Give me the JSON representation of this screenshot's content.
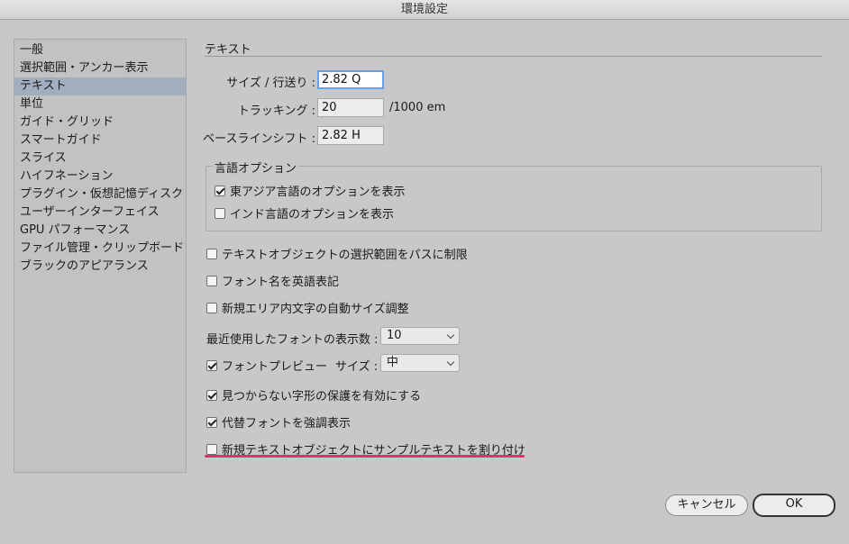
{
  "window": {
    "title": "環境設定"
  },
  "sidebar": {
    "items": [
      {
        "label": "一般"
      },
      {
        "label": "選択範囲・アンカー表示"
      },
      {
        "label": "テキスト"
      },
      {
        "label": "単位"
      },
      {
        "label": "ガイド・グリッド"
      },
      {
        "label": "スマートガイド"
      },
      {
        "label": "スライス"
      },
      {
        "label": "ハイフネーション"
      },
      {
        "label": "プラグイン・仮想記憶ディスク"
      },
      {
        "label": "ユーザーインターフェイス"
      },
      {
        "label": "GPU パフォーマンス"
      },
      {
        "label": "ファイル管理・クリップボード"
      },
      {
        "label": "ブラックのアピアランス"
      }
    ],
    "selected": "テキスト"
  },
  "panel": {
    "section_title": "テキスト",
    "size_leading": {
      "label": "サイズ / 行送り :",
      "value": "2.82 Q"
    },
    "tracking": {
      "label": "トラッキング :",
      "value": "20",
      "unit": "/1000 em"
    },
    "baseline_shift": {
      "label": "ベースラインシフト :",
      "value": "2.82 H"
    },
    "language_options": {
      "title": "言語オプション",
      "east_asian": {
        "label": "東アジア言語のオプションを表示",
        "checked": true
      },
      "indic": {
        "label": "インド言語のオプションを表示",
        "checked": false
      }
    },
    "limit_selection": {
      "label": "テキストオブジェクトの選択範囲をパスに制限",
      "checked": false
    },
    "font_names_english": {
      "label": "フォント名を英語表記",
      "checked": false
    },
    "auto_size_area": {
      "label": "新規エリア内文字の自動サイズ調整",
      "checked": false
    },
    "recent_fonts": {
      "label": "最近使用したフォントの表示数 :",
      "value": "10"
    },
    "font_preview": {
      "label": "フォントプレビュー",
      "checked": true,
      "size_label": "サイズ :",
      "size_value": "中"
    },
    "missing_glyph": {
      "label": "見つからない字形の保護を有効にする",
      "checked": true
    },
    "highlight_substituted": {
      "label": "代替フォントを強調表示",
      "checked": true
    },
    "fill_placeholder": {
      "label": "新規テキストオブジェクトにサンプルテキストを割り付け",
      "checked": false
    }
  },
  "buttons": {
    "cancel": "キャンセル",
    "ok": "OK"
  },
  "colors": {
    "highlight_underline": "#e0306e",
    "sidebar_selected": "#a0aec0",
    "focus_ring": "#6aa0e8"
  }
}
